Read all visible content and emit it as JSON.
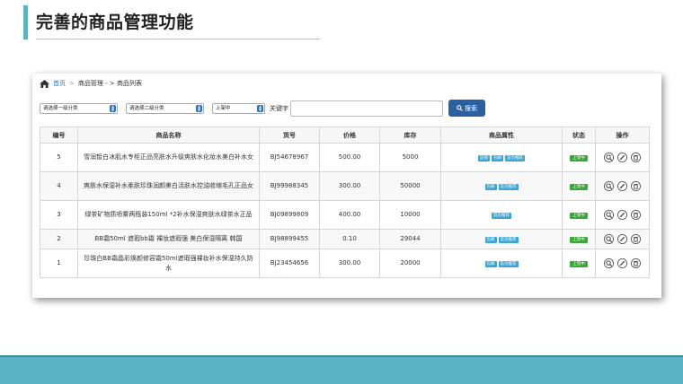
{
  "slide": {
    "title": "完善的商品管理功能"
  },
  "breadcrumb": {
    "home": "首页",
    "sep": ">",
    "path": "商品管理 - > 商品列表"
  },
  "filters": {
    "category1": "请选择一级分类",
    "category2": "请选择二级分类",
    "status": "上架中",
    "keyword_label": "关键字",
    "keyword_value": "",
    "search_label": "搜索"
  },
  "table": {
    "headers": [
      "编号",
      "商品名称",
      "货号",
      "价格",
      "库存",
      "商品属性",
      "状态",
      "操作"
    ],
    "rows": [
      {
        "id": "5",
        "name": "雪润皙白冰肌水专柜正品亮肤水升级爽肤水化妆水美白补水女",
        "sku": "BJ54678967",
        "price": "500.00",
        "stock": "5000",
        "tags": [
          "促销",
          "包邮",
          "首页推荐"
        ],
        "status": "上架中"
      },
      {
        "id": "4",
        "name": "爽肤水保湿补水柔肤珍珠润颜美白活肤水控油收缩毛孔正品女",
        "sku": "BJ99988345",
        "price": "300.00",
        "stock": "50000",
        "tags": [
          "包邮",
          "首页推荐"
        ],
        "status": "上架中"
      },
      {
        "id": "3",
        "name": "绿茶矿物质喷雾两瓶装150ml *2补水保湿爽肤水绿茶水正品",
        "sku": "BJ09899809",
        "price": "400.00",
        "stock": "10000",
        "tags": [
          "首页推荐"
        ],
        "status": "上架中"
      },
      {
        "id": "2",
        "name": "BB霜50ml 遮瑕bb霜 裸妆遮瑕强 美白保湿隔离 韩国",
        "sku": "BJ98899455",
        "price": "0.10",
        "stock": "29044",
        "tags": [
          "包邮",
          "首页推荐"
        ],
        "status": "上架中"
      },
      {
        "id": "1",
        "name": "珍珠白BB霜晶彩焕颜修容霜50ml遮瑕强裸妆补水保湿持久防水",
        "sku": "BJ23454656",
        "price": "300.00",
        "stock": "20000",
        "tags": [
          "包邮",
          "首页推荐"
        ],
        "status": "上架中"
      }
    ]
  },
  "icons": {
    "home": "home-icon",
    "search": "search-icon",
    "view": "magnifier-icon",
    "edit": "pencil-icon",
    "delete": "trash-icon"
  },
  "colors": {
    "accent": "#5bb3c1",
    "primary_button": "#2a5fa0",
    "tag": "#3aa6d6",
    "status": "#3aa83a",
    "link": "#2a73c7"
  }
}
